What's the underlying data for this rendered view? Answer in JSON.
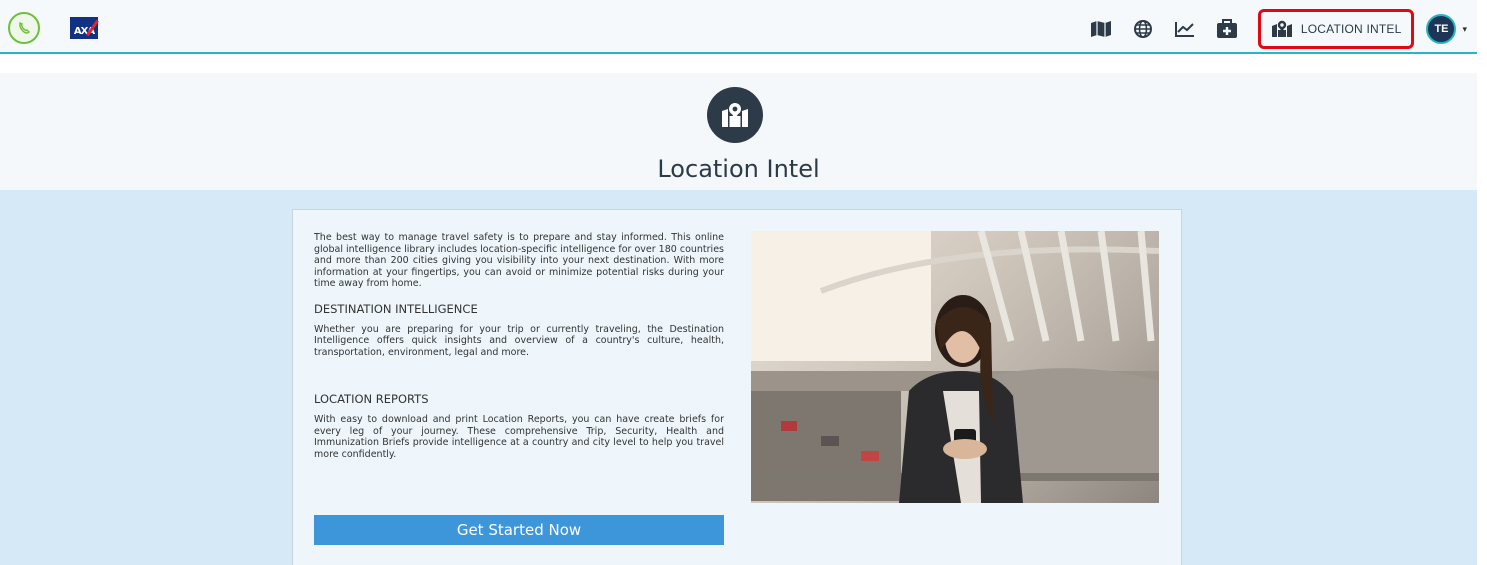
{
  "navbar": {
    "logo_text": "AXA",
    "icons": [
      "phone-icon",
      "map-icon",
      "globe-icon",
      "chart-line-icon",
      "medical-kit-icon",
      "map-pin-icon"
    ],
    "active_item_label": "LOCATION INTEL",
    "avatar_initials": "TE",
    "accent_color": "#27b5c4",
    "highlight_color": "#e30613"
  },
  "header": {
    "title": "Location Intel",
    "icon": "map-pin-icon"
  },
  "card": {
    "intro": "The best way to manage travel safety is to prepare and stay informed. This online global intelligence library includes location-specific intelligence for over 180 countries and more than 200 cities giving you visibility into your next destination. With more information at your fingertips, you can avoid or minimize potential risks during your time away from home.",
    "sections": [
      {
        "title": "DESTINATION INTELLIGENCE",
        "body": "Whether you are preparing for your trip or currently traveling, the Destination Intelligence offers quick insights and overview of a country's culture, health, transportation, environment, legal and more."
      },
      {
        "title": "LOCATION REPORTS",
        "body": "With easy to download and print Location Reports, you can have create briefs for every leg of your journey. These comprehensive Trip, Security, Health and Immunization Briefs provide intelligence at a country and city level to help you travel more confidently."
      }
    ],
    "cta_label": "Get Started Now",
    "cta_color": "#3d96d9"
  }
}
